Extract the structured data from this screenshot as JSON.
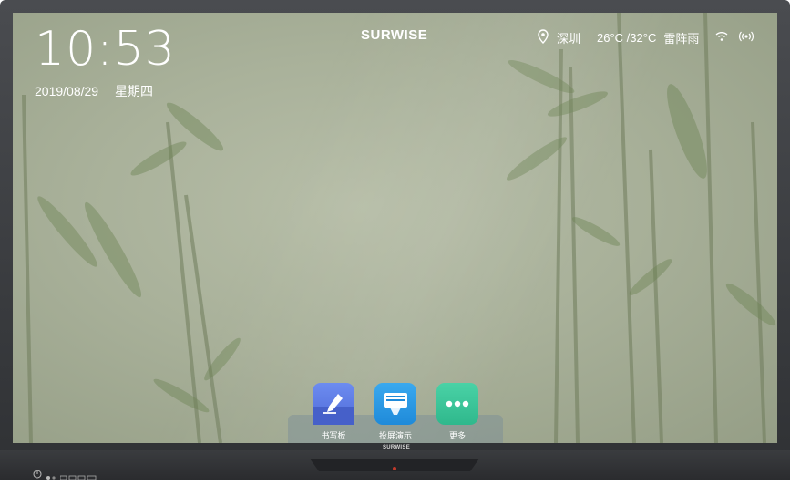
{
  "clock": {
    "time": "10:53",
    "date": "2019/08/29",
    "weekday": "星期四"
  },
  "brand": {
    "name": "SURWISE",
    "bezel_name": "SURWISE"
  },
  "status": {
    "location_icon": "location-pin-icon",
    "city": "深圳",
    "temperature": "26°C /32°C",
    "weather": "雷阵雨",
    "wifi_icon": "wifi-icon",
    "signal_icon": "hotspot-icon"
  },
  "dock": {
    "apps": [
      {
        "label": "书写板",
        "icon": "whiteboard-pen-icon",
        "color": "#5f7de8"
      },
      {
        "label": "投屏演示",
        "icon": "screen-cast-icon",
        "color": "#2e9be6"
      },
      {
        "label": "更多",
        "icon": "more-dots-icon",
        "color": "#3ec49a"
      }
    ]
  },
  "colors": {
    "accent": "#ffffff",
    "bezel": "#333538",
    "wallpaper": "#aab29b"
  }
}
